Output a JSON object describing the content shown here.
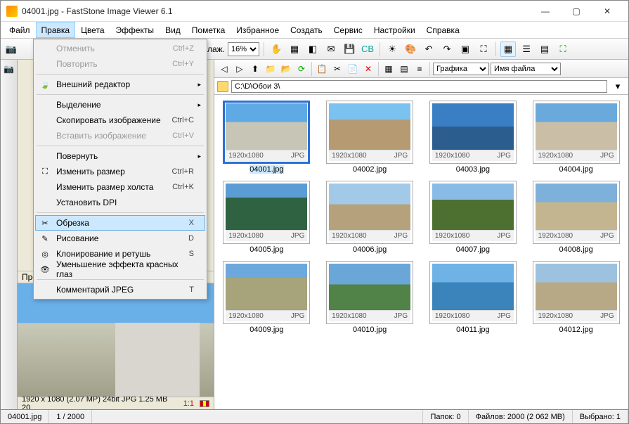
{
  "window": {
    "title": "04001.jpg - FastStone Image Viewer 6.1"
  },
  "menubar": [
    "Файл",
    "Правка",
    "Цвета",
    "Эффекты",
    "Вид",
    "Пометка",
    "Избранное",
    "Создать",
    "Сервис",
    "Настройки",
    "Справка"
  ],
  "menubar_open_index": 1,
  "dropdown": [
    {
      "type": "item",
      "label": "Отменить",
      "sc": "Ctrl+Z",
      "disabled": true
    },
    {
      "type": "item",
      "label": "Повторить",
      "sc": "Ctrl+Y",
      "disabled": true
    },
    {
      "type": "sep"
    },
    {
      "type": "item",
      "label": "Внешний редактор",
      "arrow": true,
      "icon": "leaf"
    },
    {
      "type": "sep"
    },
    {
      "type": "item",
      "label": "Выделение",
      "arrow": true
    },
    {
      "type": "item",
      "label": "Скопировать изображение",
      "sc": "Ctrl+C"
    },
    {
      "type": "item",
      "label": "Вставить изображение",
      "sc": "Ctrl+V",
      "disabled": true
    },
    {
      "type": "sep"
    },
    {
      "type": "item",
      "label": "Повернуть",
      "arrow": true
    },
    {
      "type": "item",
      "label": "Изменить размер",
      "sc": "Ctrl+R",
      "icon": "resize"
    },
    {
      "type": "item",
      "label": "Изменить размер холста",
      "sc": "Ctrl+K"
    },
    {
      "type": "item",
      "label": "Установить DPI"
    },
    {
      "type": "sep"
    },
    {
      "type": "item",
      "label": "Обрезка",
      "sc": "X",
      "icon": "crop",
      "hl": true
    },
    {
      "type": "item",
      "label": "Рисование",
      "sc": "D",
      "icon": "draw"
    },
    {
      "type": "item",
      "label": "Клонирование и ретушь",
      "sc": "S",
      "icon": "clone"
    },
    {
      "type": "item",
      "label": "Уменьшение эффекта красных глаз",
      "icon": "redeye"
    },
    {
      "type": "sep"
    },
    {
      "type": "item",
      "label": "Комментарий JPEG",
      "sc": "T"
    }
  ],
  "toolbar": {
    "zoom_label_prefix": "лаж.",
    "zoom_value": "16%",
    "dropdowns": {
      "filter": "Графика",
      "sort": "Имя файла"
    }
  },
  "path": "C:\\D\\Обои 3\\",
  "preview": {
    "caption": "Предва",
    "info": "1920 x 1080 (2.07 MP)  24bit  JPG   1.25 MB   20",
    "ratio": "1:1"
  },
  "thumbs": [
    {
      "name": "04001.jpg",
      "res": "1920x1080",
      "fmt": "JPG",
      "sel": true,
      "cls": "t1"
    },
    {
      "name": "04002.jpg",
      "res": "1920x1080",
      "fmt": "JPG",
      "cls": "t2"
    },
    {
      "name": "04003.jpg",
      "res": "1920x1080",
      "fmt": "JPG",
      "cls": "t3"
    },
    {
      "name": "04004.jpg",
      "res": "1920x1080",
      "fmt": "JPG",
      "cls": "t4"
    },
    {
      "name": "04005.jpg",
      "res": "1920x1080",
      "fmt": "JPG",
      "cls": "t5"
    },
    {
      "name": "04006.jpg",
      "res": "1920x1080",
      "fmt": "JPG",
      "cls": "t6"
    },
    {
      "name": "04007.jpg",
      "res": "1920x1080",
      "fmt": "JPG",
      "cls": "t7"
    },
    {
      "name": "04008.jpg",
      "res": "1920x1080",
      "fmt": "JPG",
      "cls": "t8"
    },
    {
      "name": "04009.jpg",
      "res": "1920x1080",
      "fmt": "JPG",
      "cls": "t9"
    },
    {
      "name": "04010.jpg",
      "res": "1920x1080",
      "fmt": "JPG",
      "cls": "t10"
    },
    {
      "name": "04011.jpg",
      "res": "1920x1080",
      "fmt": "JPG",
      "cls": "t11"
    },
    {
      "name": "04012.jpg",
      "res": "1920x1080",
      "fmt": "JPG",
      "cls": "t12"
    }
  ],
  "status": {
    "file": "04001.jpg",
    "pos": "1 / 2000",
    "folders": "Папок: 0",
    "files": "Файлов: 2000 (2 062 MB)",
    "selected": "Выбрано: 1"
  },
  "icons": {
    "leaf": "🍃",
    "resize": "⛶",
    "crop": "✂",
    "draw": "✎",
    "clone": "◎",
    "redeye": "👁"
  }
}
